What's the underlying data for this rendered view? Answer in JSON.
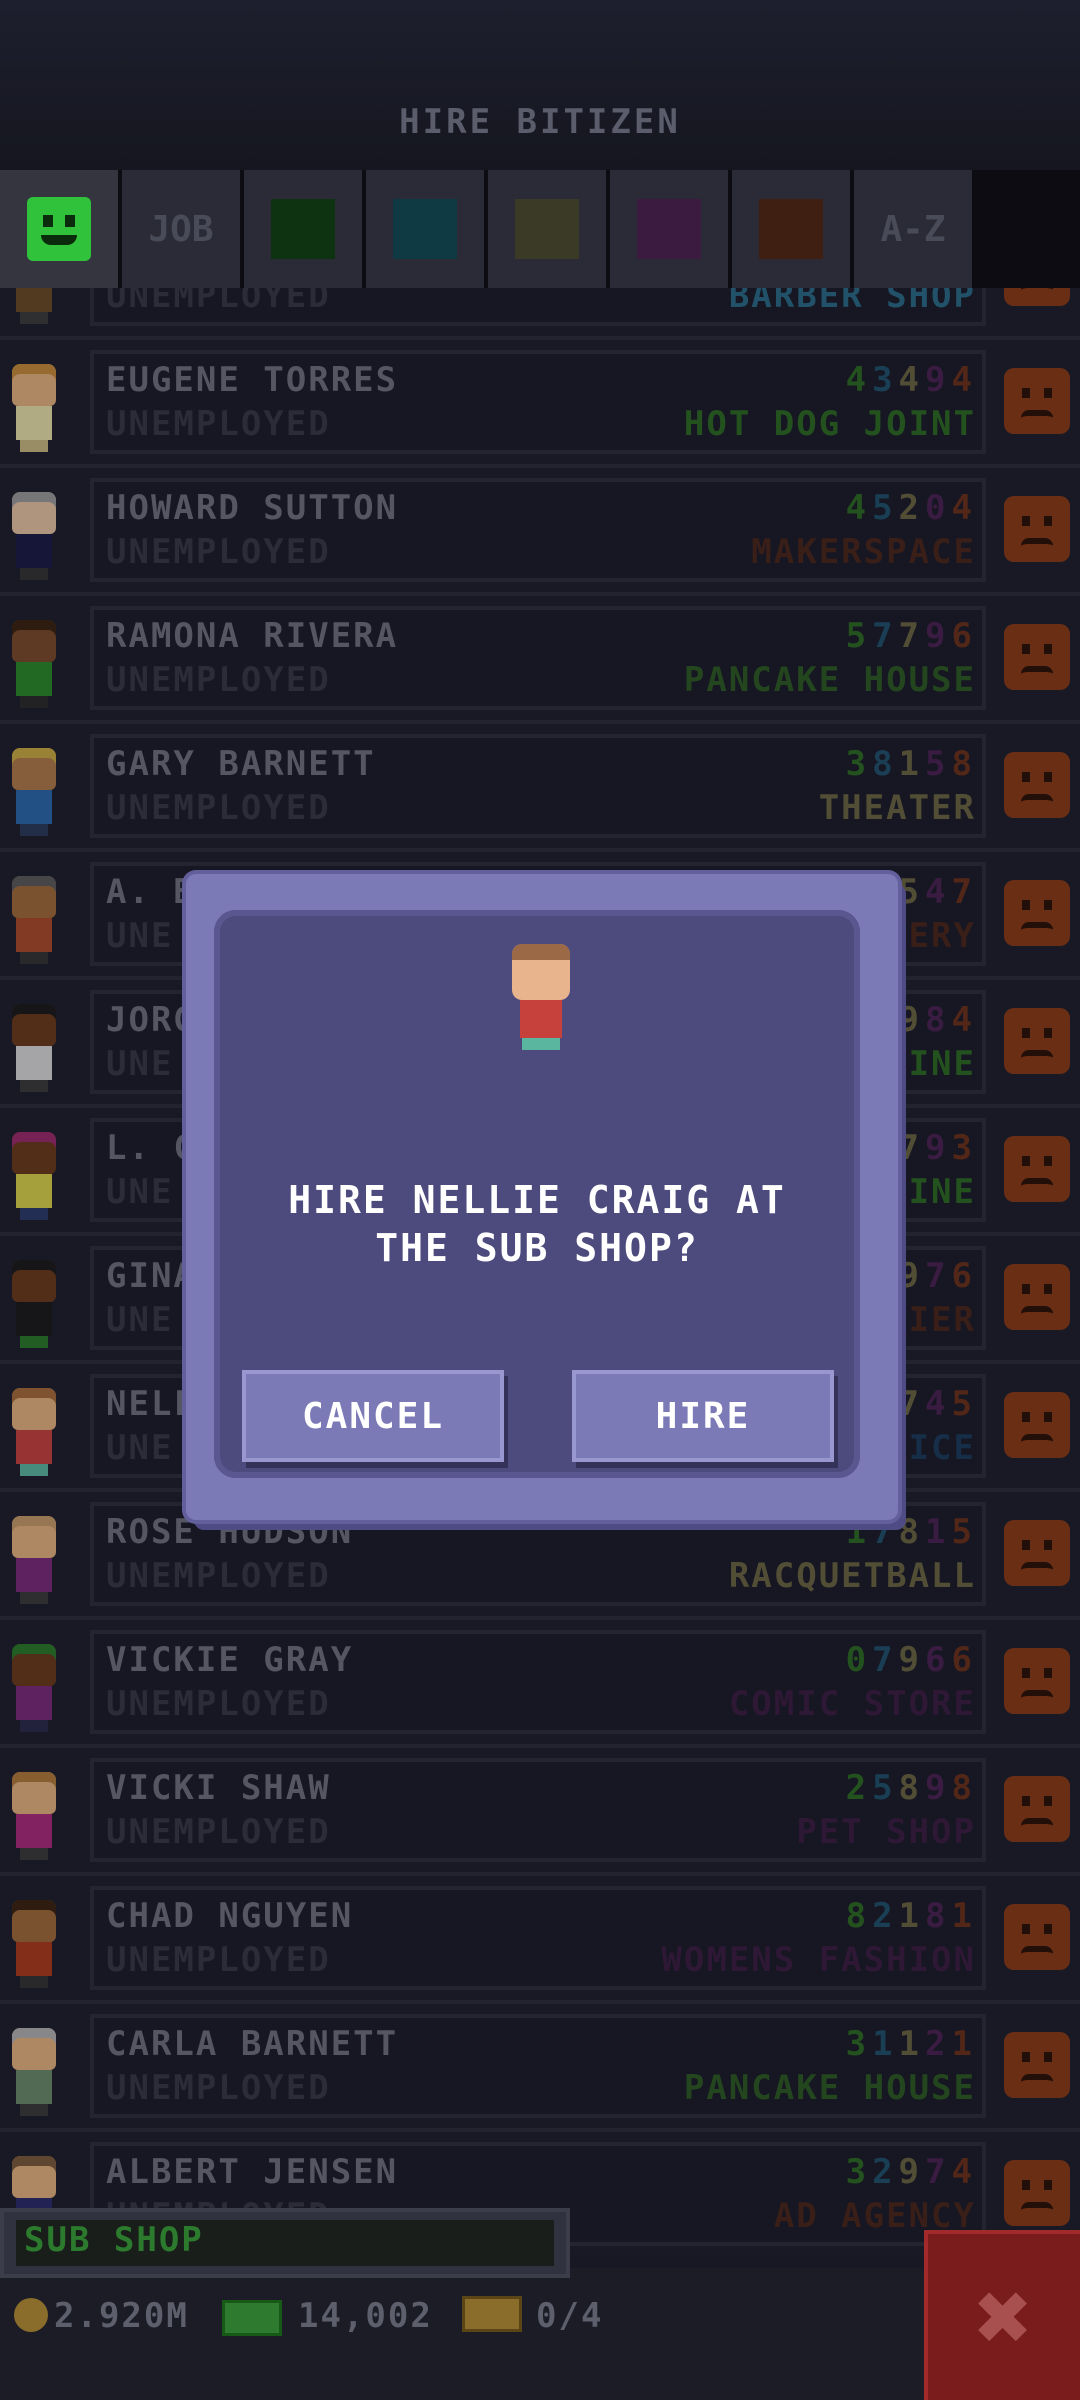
{
  "header": {
    "title": "HIRE BITIZEN"
  },
  "tabs": [
    {
      "name": "bitizen-face",
      "label": "",
      "color": "#2fc23a"
    },
    {
      "name": "job",
      "label": "JOB"
    },
    {
      "name": "food",
      "label": "",
      "color": "#0e3311"
    },
    {
      "name": "service",
      "label": "",
      "color": "#0f3a44"
    },
    {
      "name": "recreation",
      "label": "",
      "color": "#3b3a26"
    },
    {
      "name": "retail",
      "label": "",
      "color": "#3b1c40"
    },
    {
      "name": "creative",
      "label": "",
      "color": "#3f1f12"
    },
    {
      "name": "alpha",
      "label": "A-Z"
    }
  ],
  "rows": [
    {
      "name": "",
      "job": "UNEMPLOYED",
      "skills": [],
      "dream": "BARBER SHOP",
      "dream_color": "#2a6a86",
      "avatar": {
        "skin": "#c38a5a",
        "hair": "#7a4a22",
        "shirt": "#6a4a26",
        "legs": "#3b3a3a"
      }
    },
    {
      "name": "EUGENE TORRES",
      "job": "UNEMPLOYED",
      "skills": [
        "4",
        "3",
        "4",
        "9",
        "4"
      ],
      "dream": "HOT DOG JOINT",
      "dream_color": "#2c6a22",
      "avatar": {
        "skin": "#e4b07e",
        "hair": "#c68a3a",
        "shirt": "#e8e0a8",
        "legs": "#c8b880"
      }
    },
    {
      "name": "HOWARD SUTTON",
      "job": "UNEMPLOYED",
      "skills": [
        "4",
        "5",
        "2",
        "0",
        "4"
      ],
      "dream": "MAKERSPACE",
      "dream_color": "#4a241a",
      "avatar": {
        "skin": "#e6c3a0",
        "hair": "#9a9a9a",
        "shirt": "#1a1a44",
        "legs": "#333333"
      }
    },
    {
      "name": "RAMONA RIVERA",
      "job": "UNEMPLOYED",
      "skills": [
        "5",
        "7",
        "7",
        "9",
        "6"
      ],
      "dream": "PANCAKE HOUSE",
      "dream_color": "#2c5a22",
      "avatar": {
        "skin": "#7a4a2a",
        "hair": "#3a2210",
        "shirt": "#2a8a2a",
        "legs": "#2a2a2a"
      }
    },
    {
      "name": "GARY BARNETT",
      "job": "UNEMPLOYED",
      "skills": [
        "3",
        "8",
        "1",
        "5",
        "8"
      ],
      "dream": "THEATER",
      "dream_color": "#6a6440",
      "avatar": {
        "skin": "#b07a4a",
        "hair": "#c8a840",
        "shirt": "#2a66aa",
        "legs": "#2a3a5a"
      }
    },
    {
      "name": "A. BE",
      "job": "UNE",
      "skills": [
        "5",
        "4",
        "7"
      ],
      "dream": "ERY",
      "dream_color": "#4a241a",
      "avatar": {
        "skin": "#a06a3a",
        "hair": "#5a5a5a",
        "shirt": "#aa4a2a",
        "legs": "#333333"
      }
    },
    {
      "name": "JORG",
      "job": "UNE",
      "skills": [
        "9",
        "8",
        "4"
      ],
      "dream": "SINE",
      "dream_color": "#2c6a22",
      "avatar": {
        "skin": "#6a3a1a",
        "hair": "#1a1a1a",
        "shirt": "#d8d8d8",
        "legs": "#3a3a3a"
      }
    },
    {
      "name": "L. CA",
      "job": "UNE",
      "skills": [
        "7",
        "9",
        "3"
      ],
      "dream": "SINE",
      "dream_color": "#2c6a22",
      "avatar": {
        "skin": "#6a3a1a",
        "hair": "#9a2a6a",
        "shirt": "#d8d04a",
        "legs": "#2a3a6a"
      }
    },
    {
      "name": "GINA",
      "job": "UNE",
      "skills": [
        "9",
        "7",
        "6"
      ],
      "dream": "TIER",
      "dream_color": "#4a241a",
      "avatar": {
        "skin": "#6a3a1a",
        "hair": "#1a1a1a",
        "shirt": "#1a1a1a",
        "legs": "#2a7a2a"
      }
    },
    {
      "name": "NELL",
      "job": "UNE",
      "skills": [
        "7",
        "4",
        "5"
      ],
      "dream": "FICE",
      "dream_color": "#1a3a5a",
      "avatar": {
        "skin": "#e4b07e",
        "hair": "#a66a3a",
        "shirt": "#c6403c",
        "legs": "#5bb6a0"
      }
    },
    {
      "name": "ROSE HUDSON",
      "job": "UNEMPLOYED",
      "skills": [
        "1",
        "7",
        "8",
        "1",
        "5"
      ],
      "dream": "RACQUETBALL",
      "dream_color": "#6a6440",
      "avatar": {
        "skin": "#e4b07e",
        "hair": "#c69a6a",
        "shirt": "#7a2a7a",
        "legs": "#3a3a3a"
      }
    },
    {
      "name": "VICKIE GRAY",
      "job": "UNEMPLOYED",
      "skills": [
        "0",
        "7",
        "9",
        "6",
        "6"
      ],
      "dream": "COMIC STORE",
      "dream_color": "#3a1c40",
      "avatar": {
        "skin": "#6a3a1a",
        "hair": "#2a7a2a",
        "shirt": "#7a2a7a",
        "legs": "#2a2a4a"
      }
    },
    {
      "name": "VICKI SHAW",
      "job": "UNEMPLOYED",
      "skills": [
        "2",
        "5",
        "8",
        "9",
        "8"
      ],
      "dream": "PET SHOP",
      "dream_color": "#3a1c40",
      "avatar": {
        "skin": "#e4b07e",
        "hair": "#b07a3a",
        "shirt": "#aa2a7a",
        "legs": "#3a3a3a"
      }
    },
    {
      "name": "CHAD NGUYEN",
      "job": "UNEMPLOYED",
      "skills": [
        "8",
        "2",
        "1",
        "8",
        "1"
      ],
      "dream": "WOMENS FASHION",
      "dream_color": "#3a1c40",
      "avatar": {
        "skin": "#a06a3a",
        "hair": "#3a2210",
        "shirt": "#aa3a1a",
        "legs": "#333333"
      }
    },
    {
      "name": "CARLA BARNETT",
      "job": "UNEMPLOYED",
      "skills": [
        "3",
        "1",
        "1",
        "2",
        "1"
      ],
      "dream": "PANCAKE HOUSE",
      "dream_color": "#2c5a22",
      "avatar": {
        "skin": "#e4b07e",
        "hair": "#b0b0b0",
        "shirt": "#6a8a6a",
        "legs": "#3a3a3a"
      }
    },
    {
      "name": "ALBERT JENSEN",
      "job": "UNEMPLOYED",
      "skills": [
        "3",
        "2",
        "9",
        "7",
        "4"
      ],
      "dream": "AD AGENCY",
      "dream_color": "#4a241a",
      "avatar": {
        "skin": "#e4b07e",
        "hair": "#7a5a3a",
        "shirt": "#2a2a6a",
        "legs": "#333333"
      }
    }
  ],
  "skill_colors": [
    "#2c6a22",
    "#1f4f6a",
    "#6a6440",
    "#4a2252",
    "#6a301a"
  ],
  "dialog": {
    "message": "HIRE NELLIE CRAIG AT THE SUB SHOP?",
    "cancel_label": "CANCEL",
    "hire_label": "HIRE"
  },
  "footer": {
    "floor_name": "SUB SHOP",
    "coins": "2.920M",
    "bux": "14,002",
    "vip_count": "0/4",
    "close_icon": "x-icon"
  }
}
